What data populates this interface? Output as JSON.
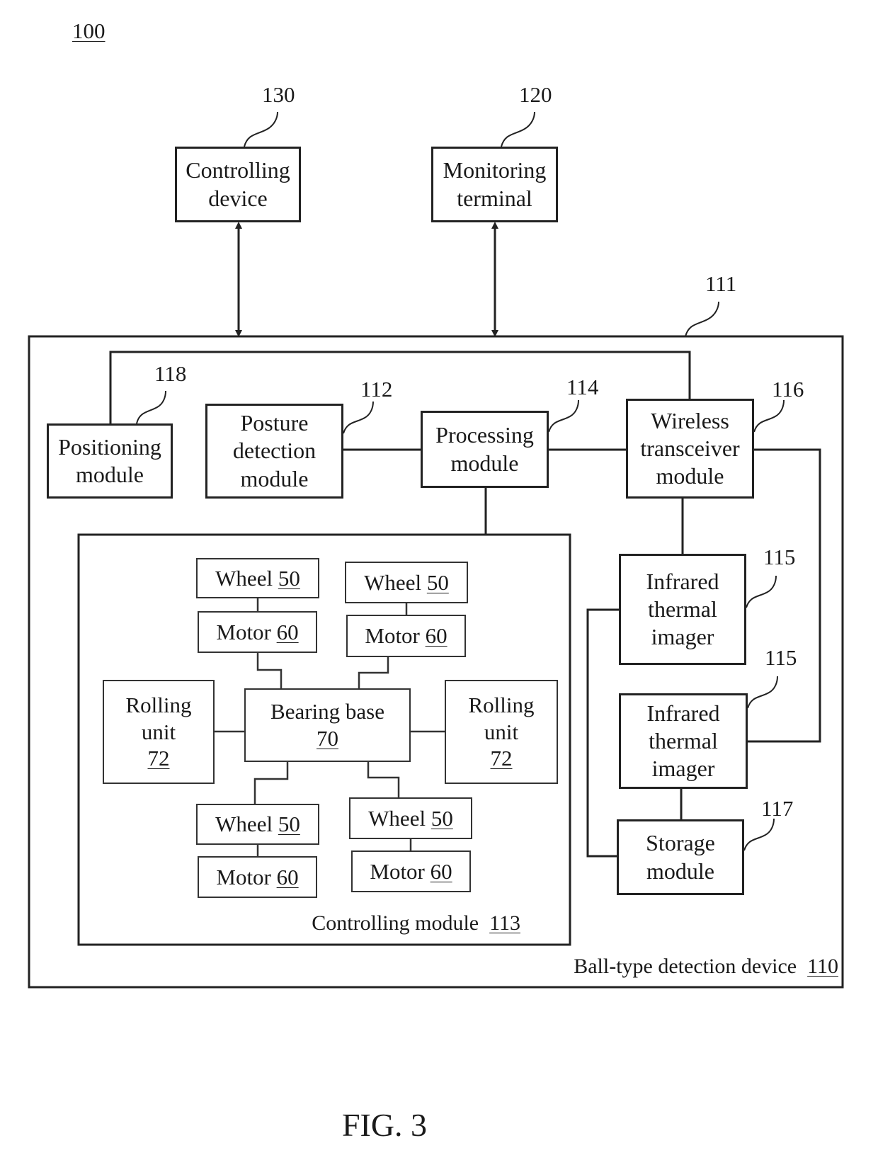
{
  "figure": {
    "system_ref": "100",
    "caption": "FIG. 3"
  },
  "external": {
    "controlling_device": {
      "lines": [
        "Controlling",
        "device"
      ],
      "ref": "130"
    },
    "monitoring_terminal": {
      "lines": [
        "Monitoring",
        "terminal"
      ],
      "ref": "120"
    }
  },
  "device": {
    "label": "Ball-type detection device",
    "ref": "110",
    "housing_ref": "111",
    "positioning": {
      "lines": [
        "Positioning",
        "module"
      ],
      "ref": "118"
    },
    "posture": {
      "lines": [
        "Posture",
        "detection",
        "module"
      ],
      "ref": "112"
    },
    "processing": {
      "lines": [
        "Processing",
        "module"
      ],
      "ref": "114"
    },
    "wireless": {
      "lines": [
        "Wireless",
        "transceiver",
        "module"
      ],
      "ref": "116"
    },
    "infrared_1": {
      "lines": [
        "Infrared",
        "thermal",
        "imager"
      ],
      "ref": "115"
    },
    "infrared_2": {
      "lines": [
        "Infrared",
        "thermal",
        "imager"
      ],
      "ref": "115"
    },
    "storage": {
      "lines": [
        "Storage",
        "module"
      ],
      "ref": "117"
    }
  },
  "controlling_module": {
    "label": "Controlling module",
    "ref": "113",
    "wheel_label": "Wheel",
    "wheel_ref": "50",
    "motor_label": "Motor",
    "motor_ref": "60",
    "bearing": {
      "label": "Bearing base",
      "ref": "70"
    },
    "rolling": {
      "lines": [
        "Rolling",
        "unit"
      ],
      "ref": "72"
    }
  }
}
